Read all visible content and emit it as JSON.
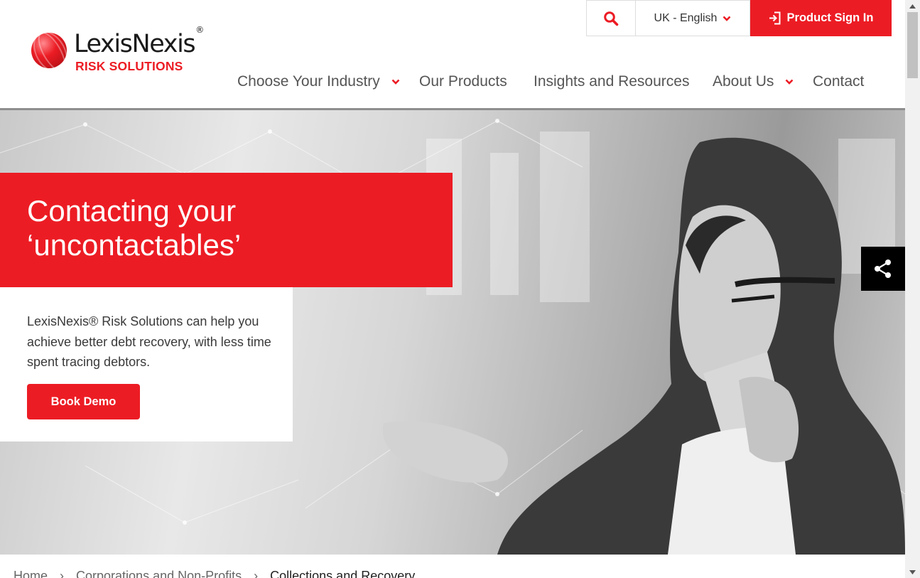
{
  "brand": {
    "name": "LexisNexis",
    "reg_mark": "®",
    "tagline": "RISK SOLUTIONS",
    "accent_color": "#ec1c24"
  },
  "utility": {
    "search_icon": "search-icon",
    "language": "UK - English",
    "sign_in": "Product Sign In",
    "sign_in_icon": "sign-in-icon"
  },
  "nav": {
    "items": [
      {
        "label": "Choose Your Industry",
        "has_dropdown": true
      },
      {
        "label": "Our Products",
        "has_dropdown": false
      },
      {
        "label": "Insights and Resources",
        "has_dropdown": false
      },
      {
        "label": "About Us",
        "has_dropdown": true
      },
      {
        "label": "Contact",
        "has_dropdown": false
      }
    ]
  },
  "hero": {
    "title_line1": "Contacting your",
    "title_line2": "‘uncontactables’",
    "description": "LexisNexis® Risk Solutions can help you achieve better debt recovery, with less time spent tracing debtors.",
    "cta": "Book Demo",
    "share_icon": "share-icon"
  },
  "breadcrumb": {
    "items": [
      "Home",
      "Corporations and Non-Profits"
    ],
    "current": "Collections and Recovery",
    "separator": "›"
  }
}
